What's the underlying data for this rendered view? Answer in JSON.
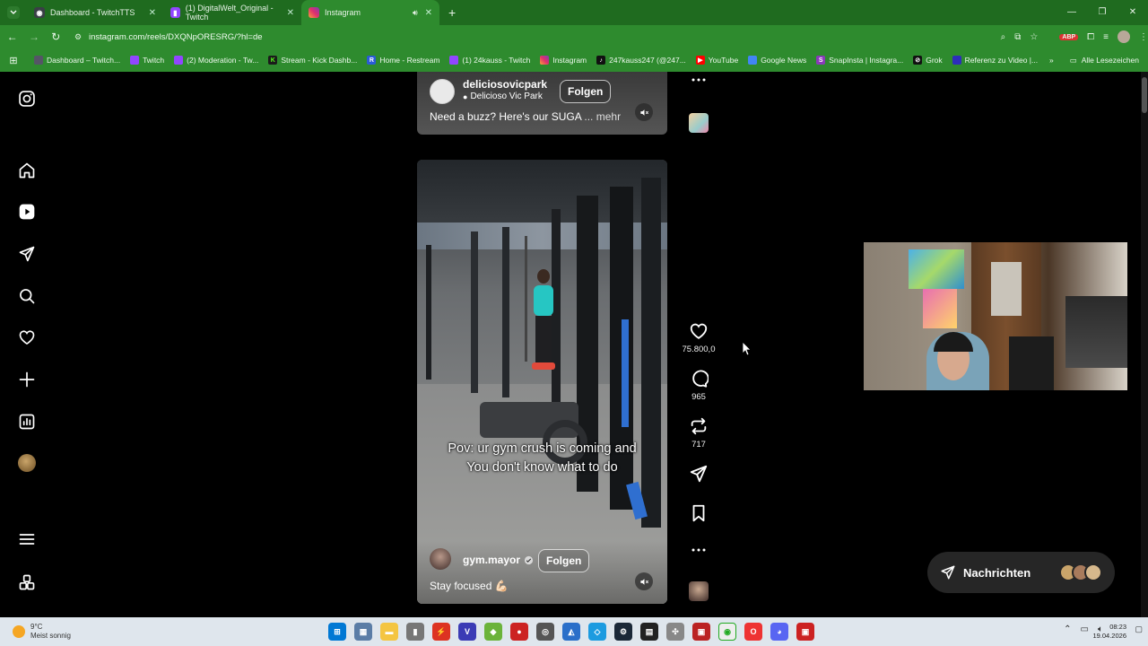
{
  "browser": {
    "tabs": [
      {
        "title": "Dashboard - TwitchTTS",
        "active": false
      },
      {
        "title": "(1) DigitalWelt_Original - Twitch",
        "active": false
      },
      {
        "title": "Instagram",
        "active": true
      }
    ],
    "url": "instagram.com/reels/DXQNpORESRG/?hl=de",
    "bookmarks": [
      "Dashboard – Twitch...",
      "Twitch",
      "(2) Moderation - Tw...",
      "Stream - Kick Dashb...",
      "Home - Restream",
      "(1) 24kauss - Twitch",
      "Instagram",
      "247kauss247 (@247...",
      "YouTube",
      "Google News",
      "SnapInsta | Instagra...",
      "Grok",
      "Referenz zu Video |..."
    ],
    "bookmarks_more": "»",
    "all_bookmarks": "Alle Lesezeichen"
  },
  "reel_top": {
    "username": "deliciosovicpark",
    "location": "Delicioso Vic Park",
    "follow_label": "Folgen",
    "caption": "Need a buzz? Here's our SUGA",
    "more": "... mehr"
  },
  "reel": {
    "overlay_text_1": "Pov: ur gym crush is coming and",
    "overlay_text_2": "You don't know what to do",
    "username": "gym.mayor",
    "follow_label": "Folgen",
    "caption": "Stay focused 💪🏻"
  },
  "actions": {
    "likes": "75.800,0",
    "comments": "965",
    "reposts": "717"
  },
  "messages": {
    "label": "Nachrichten"
  },
  "taskbar": {
    "weather_temp": "9°C",
    "weather_desc": "Meist sonnig",
    "time": "08:23",
    "date": "19.04.2026"
  },
  "colors": {
    "browser_green": "#2e8b2e",
    "tab_green": "#1f6b1f",
    "page_bg": "#000000"
  }
}
